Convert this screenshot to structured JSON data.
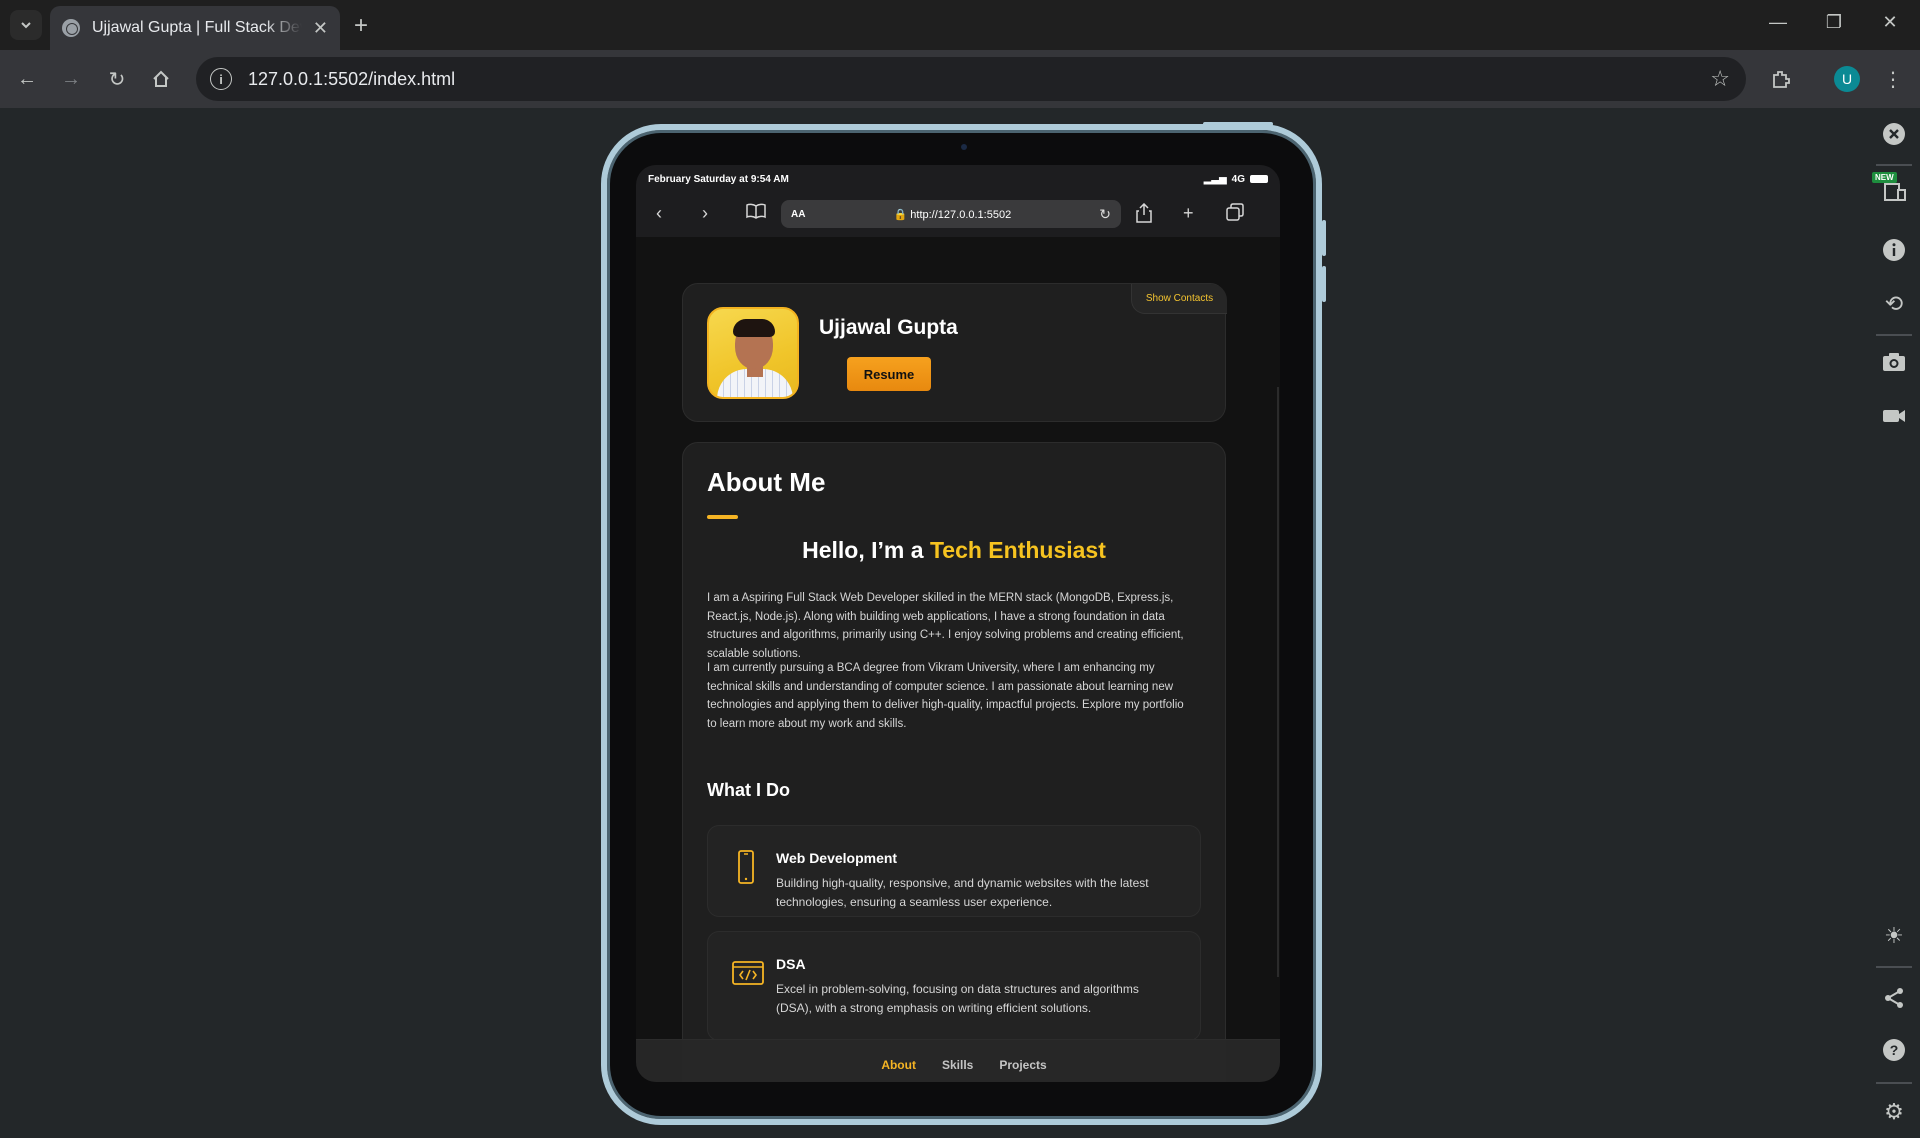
{
  "browser": {
    "tab_title": "Ujjawal Gupta | Full Stack Developer",
    "tab_close": "✕",
    "new_tab": "+",
    "url": "127.0.0.1:5502/index.html",
    "profile_initial": "U",
    "accent_profile": "#0b8a94"
  },
  "device": {
    "status_time": "February Saturday at 9:54 AM",
    "network": "4G",
    "safari_aa": "AA",
    "safari_url": "http://127.0.0.1:5502"
  },
  "profile": {
    "name": "Ujjawal Gupta",
    "resume_label": "Resume",
    "show_contacts": "Show Contacts"
  },
  "about": {
    "heading": "About Me",
    "hello_prefix": "Hello, I’m a",
    "hello_accent": "Tech Enthusiast",
    "paragraph1": "I am a Aspiring Full Stack Web Developer skilled in the MERN stack (MongoDB, Express.js, React.js, Node.js). Along with building web applications, I have a strong foundation in data structures and algorithms, primarily using C++. I enjoy solving problems and creating efficient, scalable solutions.",
    "paragraph2": "I am currently pursuing a BCA degree from Vikram University, where I am enhancing my technical skills and understanding of computer science. I am passionate about learning new technologies and applying them to deliver high-quality, impactful projects. Explore my portfolio to learn more about my work and skills.",
    "what_i_do": "What I Do",
    "services": [
      {
        "icon": "mobile-icon",
        "title": "Web Development",
        "desc": "Building high-quality, responsive, and dynamic websites with the latest technologies, ensuring a seamless user experience."
      },
      {
        "icon": "code-window-icon",
        "title": "DSA",
        "desc": "Excel in problem-solving, focusing on data structures and algorithms (DSA), with a strong emphasis on writing efficient solutions."
      }
    ]
  },
  "nav": {
    "items": [
      "About",
      "Skills",
      "Projects"
    ],
    "active": "About"
  },
  "colors": {
    "accent": "#f5b424",
    "accent_text": "#f6c320",
    "page_bg": "#121212",
    "card_bg": "#1f1f1f"
  }
}
